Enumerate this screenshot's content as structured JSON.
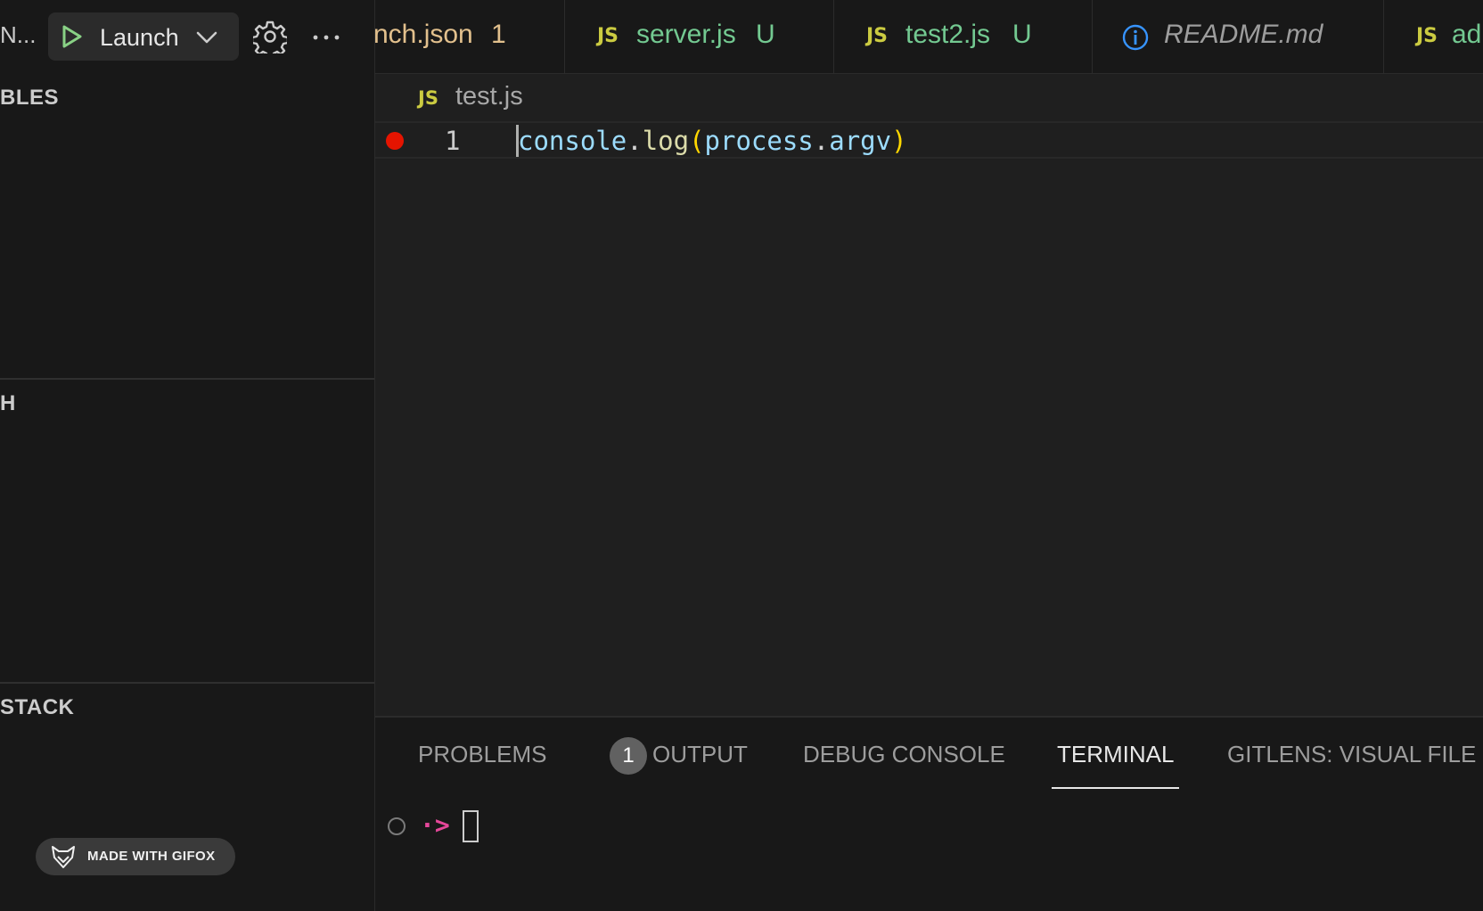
{
  "sidebar": {
    "title": "N...",
    "launch_config": "Launch",
    "sections": {
      "variables": "BLES",
      "watch": "H",
      "call_stack": "STACK"
    },
    "watermark": "MADE WITH GIFOX"
  },
  "tabs": [
    {
      "icon": "",
      "label": "nch.json",
      "badge": "1",
      "label_color": "#e2c08d",
      "badge_color": "#e2c08d"
    },
    {
      "icon": "JS",
      "label": "server.js",
      "badge": "U",
      "label_color": "#73c991",
      "badge_color": "#73c991"
    },
    {
      "icon": "JS",
      "label": "test2.js",
      "badge": "U",
      "label_color": "#73c991",
      "badge_color": "#73c991"
    },
    {
      "icon": "info-icon",
      "label": "README.md",
      "badge": "",
      "label_color": "#9d9d9d",
      "badge_color": ""
    },
    {
      "icon": "JS",
      "label": "ad",
      "badge": "",
      "label_color": "#73c991",
      "badge_color": ""
    }
  ],
  "editor": {
    "breadcrumb_icon": "JS",
    "breadcrumb_file": "test.js",
    "line_number": "1",
    "code": {
      "t1": "console",
      "t2": ".",
      "t3": "log",
      "t4": "(",
      "t5": "process",
      "t6": ".",
      "t7": "argv",
      "t8": ")"
    }
  },
  "panel": {
    "tabs": {
      "problems": "PROBLEMS",
      "problems_count": "1",
      "output": "OUTPUT",
      "debug_console": "DEBUG CONSOLE",
      "terminal": "TERMINAL",
      "gitlens": "GITLENS: VISUAL FILE"
    },
    "terminal_prompt": "·>"
  },
  "colors": {
    "js_icon": "#cbcb41",
    "breakpoint": "#e51400",
    "play_green": "#89d185",
    "info_blue": "#3794ff"
  }
}
